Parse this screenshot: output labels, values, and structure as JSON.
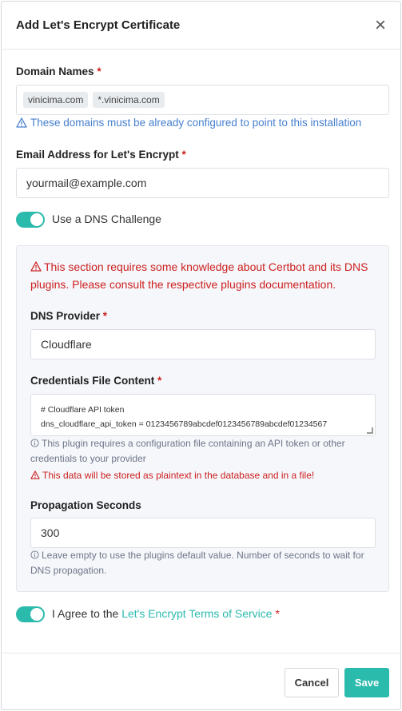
{
  "modal": {
    "title": "Add Let's Encrypt Certificate",
    "close_glyph": "×"
  },
  "domains": {
    "label": "Domain Names",
    "required": "*",
    "tags": [
      "vinicima.com",
      "*.vinicima.com"
    ],
    "hint": "These domains must be already configured to point to this installation"
  },
  "email": {
    "label": "Email Address for Let's Encrypt",
    "required": "*",
    "value": "yourmail@example.com"
  },
  "dns_toggle": {
    "label": "Use a DNS Challenge",
    "on": true
  },
  "dns_panel": {
    "warning": "This section requires some knowledge about Certbot and its DNS plugins. Please consult the respective plugins documentation.",
    "provider_label": "DNS Provider",
    "provider_required": "*",
    "provider_value": "Cloudflare",
    "credentials_label": "Credentials File Content",
    "credentials_required": "*",
    "credentials_line1": "# Cloudflare API token",
    "credentials_line2": "dns_cloudflare_api_token = 0123456789abcdef0123456789abcdef01234567",
    "credentials_info": "This plugin requires a configuration file containing an API token or other credentials to your provider",
    "credentials_warning": "This data will be stored as plaintext in the database and in a file!",
    "propagation_label": "Propagation Seconds",
    "propagation_value": "300",
    "propagation_info": "Leave empty to use the plugins default value. Number of seconds to wait for DNS propagation."
  },
  "agree": {
    "prefix": "I Agree to the",
    "link": "Let's Encrypt Terms of Service",
    "required": "*",
    "on": true
  },
  "footer": {
    "cancel_label": "Cancel",
    "save_label": "Save"
  },
  "colors": {
    "accent": "#2bbbad",
    "danger": "#cd201f",
    "info": "#467fcf"
  },
  "icons": [
    "close-icon",
    "alert-triangle-icon",
    "info-circle-icon"
  ]
}
